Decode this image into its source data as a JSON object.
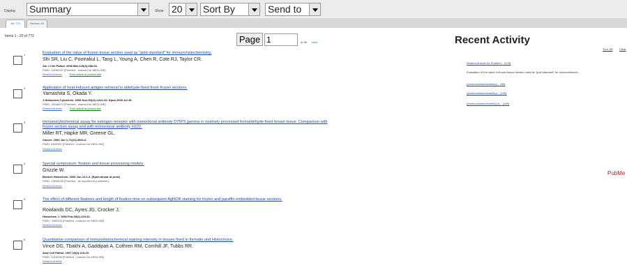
{
  "toolbar": {
    "display_label": "Display",
    "format": "Summary",
    "show_label": "Show",
    "per_page": "20",
    "sort": "Sort By",
    "send": "Send to"
  },
  "tabs": [
    {
      "label": "All: 773"
    },
    {
      "label": "Review: 45"
    }
  ],
  "pager": {
    "items_count": "Items 1 - 20 of 773",
    "page_button": "Page",
    "page_value": "1",
    "of_pages": "of 39",
    "next": "Next"
  },
  "results": [
    {
      "num": "1",
      "title": "Evaluation of the value of frozen tissue section used as \"gold standard\" for immunohistochemistry.",
      "authors": "Shi SR, Liu C, Pootrakul L, Tang L, Young A, Chen R, Cote RJ, Taylor CR.",
      "journal": "Am J Clin Pathol. 2008 Mar;129(3):358-66.",
      "pmid": "PMID: 18285257 [PubMed - indexed for MEDLINE]",
      "related": "Related Articles",
      "free": "Free article at journal site"
    },
    {
      "num": "2",
      "title": "Application of heat-induced antigen retrieval to aldehyde-fixed fresh frozen sections.",
      "authors": "Yamashita S, Okada Y.",
      "journal": "J Histochem Cytochem. 2005 Nov;53(11):1421-32. Epub 2005 Jul 25.",
      "pmid": "PMID: 16046672 [PubMed - indexed for MEDLINE]",
      "related": "Related Articles",
      "free": "Free article at journal site"
    },
    {
      "num": "3",
      "title": "Immunocytochemical assay for estrogen receptor with monoclonal antibody D75P3 gamma in routinely processed formaldehyde-fixed breast tissue. Comparison with frozen section assay and with monoclonal antibody H222.",
      "authors": "Miller RT, Hapke MR, Greene GL.",
      "journal": "Cancer. 1993 Jun 1;71(11):3541-6.",
      "pmid": "PMID: 8490902 [PubMed - indexed for MEDLINE]",
      "related": "Related Articles",
      "free": ""
    },
    {
      "num": "4",
      "title": "Special symposium: fixation and tissue processing models.",
      "authors": "Grizzle W.",
      "journal": "Biotech Histochem. 2009 Jun 22:1-3. [Epub ahead of print]",
      "pmid": "PMID: 19548155 [PubMed - as supplied by publisher]",
      "related": "Related Articles",
      "free": ""
    },
    {
      "num": "5",
      "title": "The effect of different fixatives and length of fixation time on subsequent AgNOR staining for frozen and paraffin-embedded tissue sections.",
      "authors": "Rowlands DC, Ayres JG, Crocker J.",
      "journal": "Histochem J. 1993 Feb;25(2):129-32.",
      "pmid": "PMID: 7682206 [PubMed - indexed for MEDLINE]",
      "related": "Related Articles",
      "free": ""
    },
    {
      "num": "6",
      "title": "Quantitative comparison of immunohistochemical staining intensity in tissues fixed in formalin and Histochoice.",
      "authors": "Vince DG, Tbakhi A, Gaddipati A, Cothren RM, Cornhill JF, Tubbs RR.",
      "journal": "Anal Cell Pathol. 1997;15(2):119-29.",
      "pmid": "PMID: 9416096 [PubMed - indexed for MEDLINE]",
      "related": "Related Articles",
      "free": ""
    }
  ],
  "recent_activity": {
    "title": "Recent Activity",
    "turn_off": "Turn Off",
    "clear": "Clear",
    "items": [
      {
        "label": "Related Articles for PubMed...",
        "count": "(175)",
        "link": true
      },
      {
        "label": "Evaluation of the value of frozen tissue section used as \"gold standard\" for immunohistoch...",
        "count": "",
        "link": false
      },
      {
        "label": "((immunohistochemistry)...",
        "count": "(50)",
        "link": true
      },
      {
        "label": "((immunohistochemistry)...",
        "count": "(140)",
        "link": true
      },
      {
        "label": "((immunohistochemistry) A...",
        "count": "(149)",
        "link": true
      }
    ]
  },
  "side_brand": "PubMe"
}
